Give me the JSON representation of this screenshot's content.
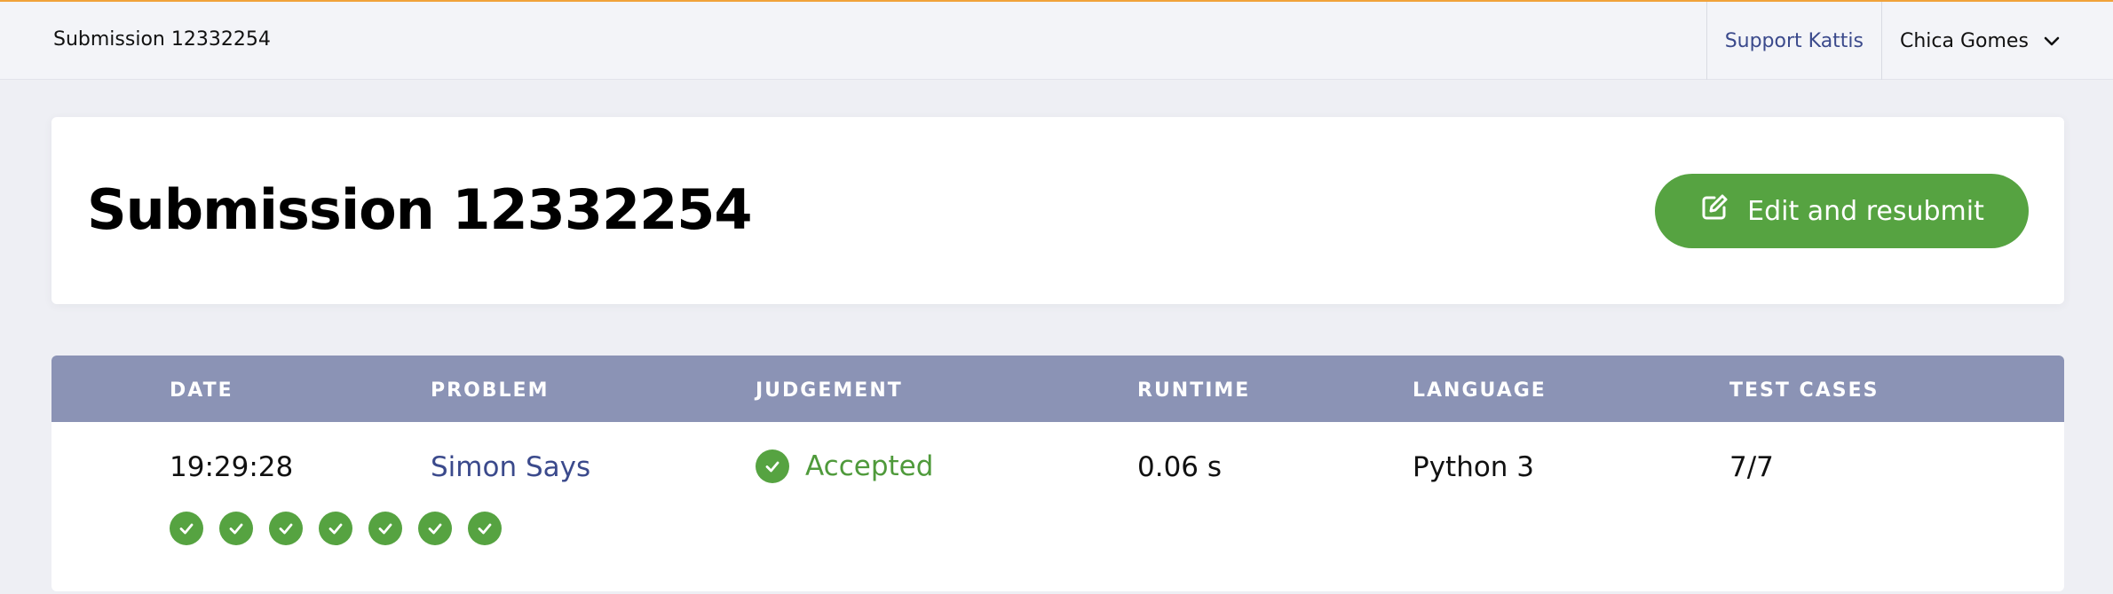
{
  "topbar": {
    "breadcrumb": "Submission 12332254",
    "support_link": "Support Kattis",
    "user_name": "Chica Gomes"
  },
  "header": {
    "title": "Submission 12332254",
    "resubmit_label": "Edit and resubmit"
  },
  "table": {
    "columns": [
      "DATE",
      "PROBLEM",
      "JUDGEMENT",
      "RUNTIME",
      "LANGUAGE",
      "TEST CASES"
    ],
    "row": {
      "date": "19:29:28",
      "problem": "Simon Says",
      "judgement": "Accepted",
      "runtime": "0.06 s",
      "language": "Python 3",
      "test_cases": "7/7"
    },
    "test_case_results": [
      "passed",
      "passed",
      "passed",
      "passed",
      "passed",
      "passed",
      "passed"
    ]
  },
  "icons": {
    "resubmit": "edit-icon",
    "user_menu": "chevron-down-icon",
    "accepted": "check-circle-icon"
  },
  "colors": {
    "accent_bar": "#f0a23a",
    "success": "#56a341",
    "table_header": "#8b93b5",
    "link": "#3b4a8c"
  }
}
